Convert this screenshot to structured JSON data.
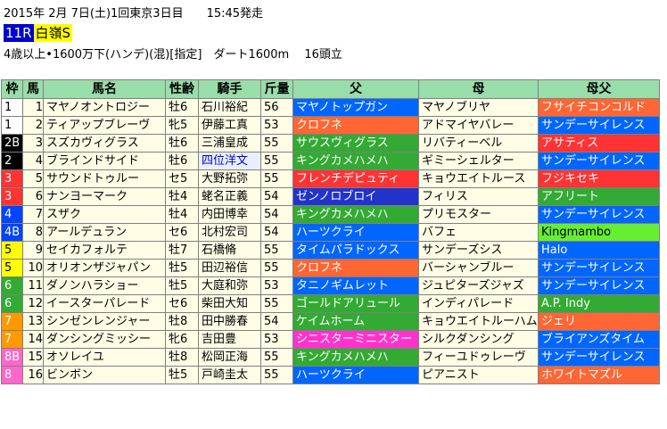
{
  "header": {
    "line1": "2015年 2月 7日(土)1回東京3日目　　15:45発走",
    "race_no": "11R",
    "race_name": "白嶺S",
    "line3": "4歳以上•1600万下(ハンデ)(混)[指定]　ダート1600m　 16頭立"
  },
  "columns": [
    "枠",
    "馬",
    "馬名",
    "性齢",
    "騎手",
    "斤量",
    "父",
    "母",
    "母父"
  ],
  "colors": {
    "blue": "#0066ff",
    "orange": "#ff6633",
    "green": "#33aa33",
    "red": "#ff3333",
    "pink": "#ff33cc",
    "teal": "#33aaaa",
    "lightblue": "#33aaff",
    "lime": "#66ee33"
  },
  "rows": [
    {
      "waku": "1",
      "uma": "1",
      "name": "マヤノオントロジー",
      "sexage": "牡6",
      "jockey": "石川裕紀",
      "weight": "56",
      "sire": "マヤノトップガン",
      "dam": "マヤノブリヤ",
      "damsire": "フサイチコンコルド"
    },
    {
      "waku": "1",
      "uma": "2",
      "name": "ティアップブレーヴ",
      "sexage": "牝5",
      "jockey": "伊藤工真",
      "weight": "53",
      "sire": "クロフネ",
      "dam": "アドマイヤバレー",
      "damsire": "サンデーサイレンス"
    },
    {
      "waku": "2B",
      "uma": "3",
      "name": "スズカヴィグラス",
      "sexage": "牡6",
      "jockey": "三浦皇成",
      "weight": "55",
      "sire": "サウスヴィグラス",
      "dam": "リバティーベル",
      "damsire": "アサティス"
    },
    {
      "waku": "2",
      "uma": "4",
      "name": "ブラインドサイド",
      "sexage": "牡6",
      "jockey": "四位洋文",
      "weight": "55",
      "sire": "キングカメハメハ",
      "dam": "ギミーシェルター",
      "damsire": "サンデーサイレンス"
    },
    {
      "waku": "3",
      "uma": "5",
      "name": "サウンドトゥルー",
      "sexage": "セ5",
      "jockey": "大野拓弥",
      "weight": "55",
      "sire": "フレンチデピュティ",
      "dam": "キョウエイトルース",
      "damsire": "フジキセキ"
    },
    {
      "waku": "3",
      "uma": "6",
      "name": "ナンヨーマーク",
      "sexage": "牡4",
      "jockey": "蛯名正義",
      "weight": "54",
      "sire": "ゼンノロブロイ",
      "dam": "フィリス",
      "damsire": "アフリート"
    },
    {
      "waku": "4",
      "uma": "7",
      "name": "スザク",
      "sexage": "牡4",
      "jockey": "内田博幸",
      "weight": "54",
      "sire": "キングカメハメハ",
      "dam": "プリモスター",
      "damsire": "サンデーサイレンス"
    },
    {
      "waku": "4B",
      "uma": "8",
      "name": "アールデュラン",
      "sexage": "セ6",
      "jockey": "北村宏司",
      "weight": "54",
      "sire": "ハーツクライ",
      "dam": "バフェ",
      "damsire": "Kingmambo"
    },
    {
      "waku": "5",
      "uma": "9",
      "name": "セイカフォルテ",
      "sexage": "牡7",
      "jockey": "石橋脩",
      "weight": "55",
      "sire": "タイムパラドックス",
      "dam": "サンデーズシス",
      "damsire": "Halo"
    },
    {
      "waku": "5",
      "uma": "10",
      "name": "オリオンザジャパン",
      "sexage": "牡5",
      "jockey": "田辺裕信",
      "weight": "55",
      "sire": "クロフネ",
      "dam": "バーシャンブルー",
      "damsire": "サンデーサイレンス"
    },
    {
      "waku": "6",
      "uma": "11",
      "name": "ダノンハラショー",
      "sexage": "牡5",
      "jockey": "大庭和弥",
      "weight": "53",
      "sire": "タニノギムレット",
      "dam": "ジュピターズジャズ",
      "damsire": "サンデーサイレンス"
    },
    {
      "waku": "6",
      "uma": "12",
      "name": "イースターパレード",
      "sexage": "セ6",
      "jockey": "柴田大知",
      "weight": "55",
      "sire": "ゴールドアリュール",
      "dam": "インディパレード",
      "damsire": "A.P. Indy"
    },
    {
      "waku": "7",
      "uma": "13",
      "name": "シンゼンレンジャー",
      "sexage": "牡8",
      "jockey": "田中勝春",
      "weight": "54",
      "sire": "ケイムホーム",
      "dam": "キョウエイトルーハム",
      "damsire": "ジェリ"
    },
    {
      "waku": "7",
      "uma": "14",
      "name": "ダンシングミッシー",
      "sexage": "牝6",
      "jockey": "吉田豊",
      "weight": "53",
      "sire": "シニスターミニスター",
      "dam": "シルクダンシング",
      "damsire": "ブライアンズタイム"
    },
    {
      "waku": "8B",
      "uma": "15",
      "name": "オソレイユ",
      "sexage": "牡8",
      "jockey": "松岡正海",
      "weight": "55",
      "sire": "キングカメハメハ",
      "dam": "フィーユドゥレーヴ",
      "damsire": "サンデーサイレンス"
    },
    {
      "waku": "8",
      "uma": "16",
      "name": "ビンボン",
      "sexage": "牡5",
      "jockey": "戸崎圭太",
      "weight": "55",
      "sire": "ハーツクライ",
      "dam": "ピアニスト",
      "damsire": "ホワイトマズル"
    }
  ]
}
